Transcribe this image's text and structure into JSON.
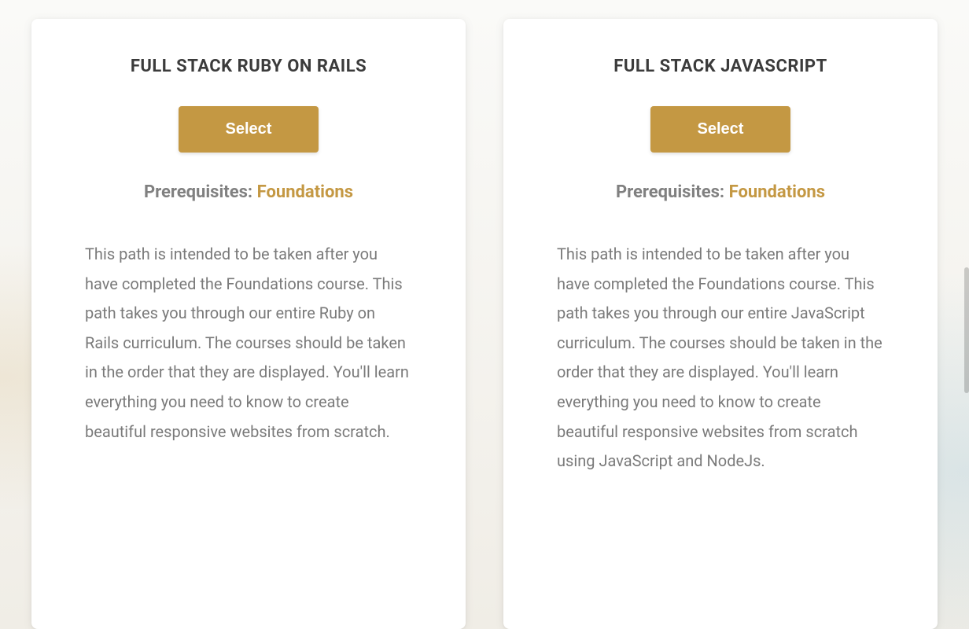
{
  "paths": [
    {
      "title": "FULL STACK RUBY ON RAILS",
      "select_label": "Select",
      "prereq_label": "Prerequisites: ",
      "prereq_link_text": "Foundations",
      "description": "This path is intended to be taken after you have completed the Foundations course. This path takes you through our entire Ruby on Rails curriculum. The courses should be taken in the order that they are displayed. You'll learn everything you need to know to create beautiful responsive websites from scratch."
    },
    {
      "title": "FULL STACK JAVASCRIPT",
      "select_label": "Select",
      "prereq_label": "Prerequisites: ",
      "prereq_link_text": "Foundations",
      "description": "This path is intended to be taken after you have completed the Foundations course. This path takes you through our entire JavaScript curriculum. The courses should be taken in the order that they are displayed. You'll learn everything you need to know to create beautiful responsive websites from scratch using JavaScript and NodeJs."
    }
  ],
  "colors": {
    "accent": "#c49843"
  }
}
